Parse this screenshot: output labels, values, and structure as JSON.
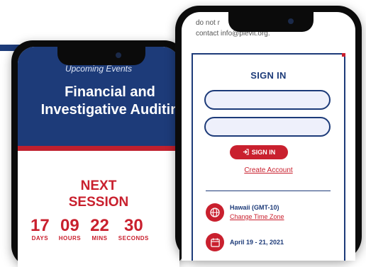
{
  "left_phone": {
    "kicker": "Upcoming Events",
    "title_line1": "Financial and",
    "title_line2": "Investigative Auditin",
    "next_line1": "NEXT",
    "next_line2": "SESSION",
    "countdown": [
      {
        "value": "17",
        "label": "DAYS"
      },
      {
        "value": "09",
        "label": "HOURS"
      },
      {
        "value": "22",
        "label": "MINS"
      },
      {
        "value": "30",
        "label": "SECONDS"
      }
    ]
  },
  "right_phone": {
    "contact_line1": "do not r                              se",
    "contact_line2": "contact info@pievit.org.",
    "signin": {
      "title": "SIGN IN",
      "username_placeholder": "",
      "password_placeholder": "",
      "button_label": "SIGN IN",
      "button_icon": "sign-in-icon",
      "create_account": "Create Account"
    },
    "timezone": {
      "icon": "globe-icon",
      "label": "Hawaii (GMT-10)",
      "link": "Change Time Zone"
    },
    "date": {
      "icon": "calendar-icon",
      "label": "April 19 - 21, 2021"
    }
  },
  "colors": {
    "navy": "#1d3b79",
    "red": "#c9202e",
    "field_bg": "#eef0fb"
  }
}
